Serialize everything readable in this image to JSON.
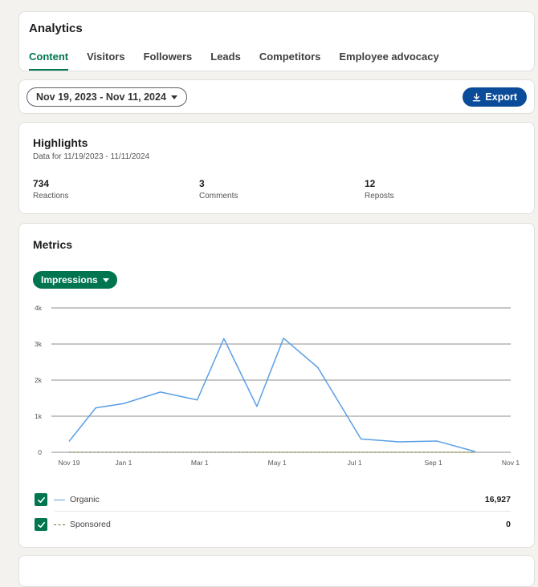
{
  "nav": {
    "title": "Analytics",
    "tabs": [
      {
        "label": "Content",
        "active": true
      },
      {
        "label": "Visitors",
        "active": false
      },
      {
        "label": "Followers",
        "active": false
      },
      {
        "label": "Leads",
        "active": false
      },
      {
        "label": "Competitors",
        "active": false
      },
      {
        "label": "Employee advocacy",
        "active": false
      }
    ]
  },
  "range": {
    "label": "Nov 19, 2023 - Nov 11, 2024",
    "export_label": "Export"
  },
  "highlights": {
    "title": "Highlights",
    "subtitle": "Data for 11/19/2023 - 11/11/2024",
    "stats": [
      {
        "value": "734",
        "label": "Reactions"
      },
      {
        "value": "3",
        "label": "Comments"
      },
      {
        "value": "12",
        "label": "Reposts"
      }
    ]
  },
  "metrics": {
    "title": "Metrics",
    "selected_metric": "Impressions"
  },
  "colors": {
    "accent_green": "#01754f",
    "export_blue": "#0a4c99",
    "organic_line": "#5a9fe6",
    "sponsored_line": "#6b6b2a"
  },
  "chart_data": {
    "type": "line",
    "y_ticks": [
      "4k",
      "3k",
      "2k",
      "1k",
      "0"
    ],
    "ylim": [
      0,
      4000
    ],
    "x_ticks": [
      "Nov 19",
      "Jan 1",
      "Mar 1",
      "May 1",
      "Jul 1",
      "Sep 1",
      "Nov 1"
    ],
    "x": [
      "2023-11-19",
      "2023-12-10",
      "2024-01-01",
      "2024-01-30",
      "2024-02-28",
      "2024-03-20",
      "2024-04-15",
      "2024-05-06",
      "2024-06-02",
      "2024-07-06",
      "2024-08-05",
      "2024-09-04",
      "2024-10-04",
      "2024-11-01"
    ],
    "series": [
      {
        "name": "Organic",
        "values": [
          300,
          1230,
          1350,
          1670,
          1450,
          3150,
          1270,
          3160,
          2350,
          370,
          290,
          310,
          20
        ],
        "total": "16,927",
        "style": "solid"
      },
      {
        "name": "Sponsored",
        "values": [
          0,
          0,
          0,
          0,
          0,
          0,
          0,
          0,
          0,
          0,
          0,
          0,
          0
        ],
        "total": "0",
        "style": "dashed"
      }
    ],
    "grid": true,
    "legend_placement": "bottom"
  }
}
